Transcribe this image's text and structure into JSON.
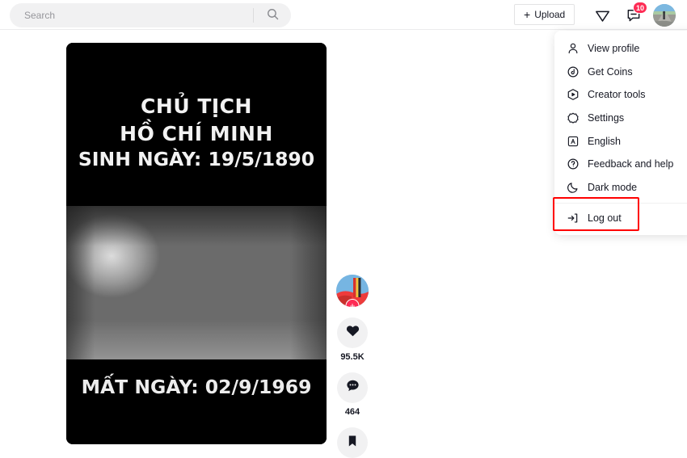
{
  "header": {
    "search": {
      "placeholder": "Search",
      "value": "",
      "icon": "search-icon"
    },
    "upload": {
      "plus": "+",
      "label": "Upload",
      "icon": "plus-icon"
    },
    "send_icon": "paper-plane-icon",
    "inbox_icon": "message-bubble-icon",
    "inbox_badge": "10",
    "avatar": "user-avatar"
  },
  "profile_menu": {
    "items": [
      {
        "label": "View profile",
        "icon": "person-icon"
      },
      {
        "label": "Get Coins",
        "icon": "coin-icon"
      },
      {
        "label": "Creator tools",
        "icon": "creator-tools-icon"
      },
      {
        "label": "Settings",
        "icon": "gear-icon"
      },
      {
        "label": "English",
        "icon": "language-icon"
      },
      {
        "label": "Feedback and help",
        "icon": "question-circle-icon"
      },
      {
        "label": "Dark mode",
        "icon": "moon-icon"
      },
      {
        "label": "Log out",
        "icon": "logout-icon"
      }
    ],
    "highlighted_item": "Log out",
    "highlight_color": "#ff0000"
  },
  "video": {
    "title_line1": "CHỦ TỊCH",
    "title_line2": "HỒ CHÍ MINH",
    "title_line3": "SINH NGÀY: 19/5/1890",
    "caption": "MẤT NGÀY: 02/9/1969"
  },
  "actions": {
    "author_avatar": "author-avatar",
    "follow_label": "+",
    "like": {
      "icon": "heart-icon",
      "count": "95.5K"
    },
    "comment": {
      "icon": "comment-icon",
      "count": "464"
    },
    "bookmark": {
      "icon": "bookmark-icon",
      "count": ""
    }
  },
  "colors": {
    "accent_red": "#fe2c55",
    "highlight": "#ff0000",
    "chip_bg": "#f1f1f2"
  }
}
